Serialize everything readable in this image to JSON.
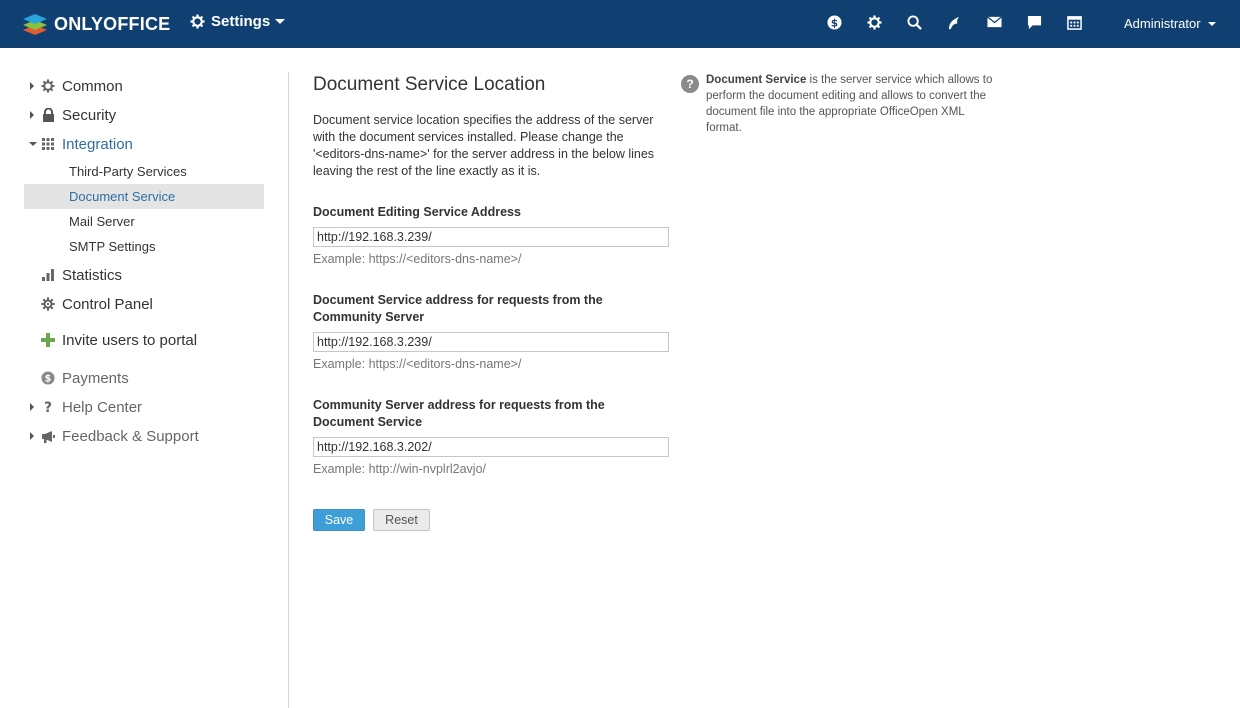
{
  "header": {
    "logo_text": "ONLYOFFICE",
    "module_label": "Settings",
    "user_label": "Administrator",
    "icons": [
      "payments-icon",
      "settings-icon",
      "search-icon",
      "feed-icon",
      "mail-icon",
      "chat-icon",
      "calendar-icon"
    ]
  },
  "sidebar": {
    "common": "Common",
    "security": "Security",
    "integration": "Integration",
    "integration_items": [
      "Third-Party Services",
      "Document Service",
      "Mail Server",
      "SMTP Settings"
    ],
    "statistics": "Statistics",
    "control_panel": "Control Panel",
    "invite": "Invite users to portal",
    "payments": "Payments",
    "help_center": "Help Center",
    "feedback": "Feedback & Support"
  },
  "main": {
    "title": "Document Service Location",
    "description": "Document service location specifies the address of the server with the document services installed. Please change the '<editors-dns-name>' for the server address in the below lines leaving the rest of the line exactly as it is.",
    "fields": [
      {
        "label": "Document Editing Service Address",
        "value": "http://192.168.3.239/",
        "example": "Example: https://<editors-dns-name>/"
      },
      {
        "label": "Document Service address for requests from the Community Server",
        "value": "http://192.168.3.239/",
        "example": "Example: https://<editors-dns-name>/"
      },
      {
        "label": "Community Server address for requests from the Document Service",
        "value": "http://192.168.3.202/",
        "example": "Example: http://win-nvplrl2avjo/"
      }
    ],
    "save_label": "Save",
    "reset_label": "Reset"
  },
  "help": {
    "term": "Document Service",
    "text": " is the server service which allows to perform the document editing and allows to convert the document file into the appropriate OfficeOpen XML format."
  },
  "colors": {
    "header_bg": "#0f4071",
    "accent": "#3e9ed8",
    "active_link": "#2d6ea3"
  }
}
